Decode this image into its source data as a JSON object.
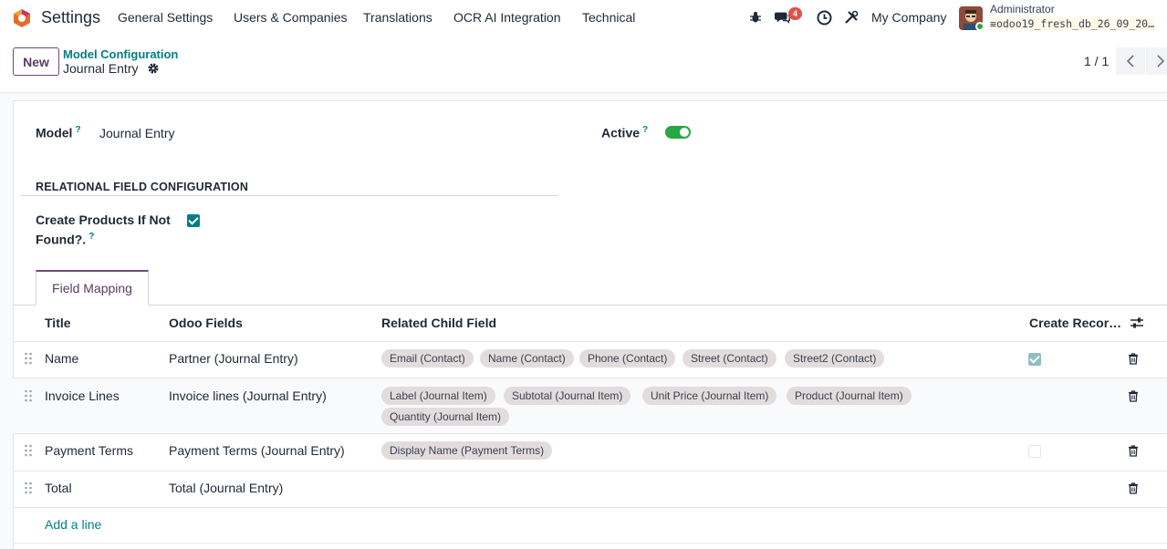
{
  "navbar": {
    "app_name": "Settings",
    "menu": [
      "General Settings",
      "Users & Companies",
      "Translations",
      "OCR AI Integration",
      "Technical"
    ],
    "message_badge": "4",
    "company": "My Company",
    "user": "Administrator",
    "database": "odoo19_fresh_db_26_09_20…"
  },
  "control": {
    "new_label": "New",
    "breadcrumb_parent": "Model Configuration",
    "breadcrumb_current": "Journal Entry",
    "pager": "1 / 1"
  },
  "form": {
    "model_label": "Model",
    "model_value": "Journal Entry",
    "active_label": "Active",
    "active": true,
    "section_title": "RELATIONAL FIELD CONFIGURATION",
    "create_products_label_1": "Create Products If Not",
    "create_products_label_2": "Found?.",
    "create_products": true,
    "help_mark": "?"
  },
  "tabs": [
    {
      "label": "Field Mapping",
      "active": true
    }
  ],
  "table": {
    "headers": [
      "Title",
      "Odoo Fields",
      "Related Child Field",
      "Create Recor…"
    ],
    "rows": [
      {
        "title": "Name",
        "field": "Partner (Journal Entry)",
        "tags": [
          "Email (Contact)",
          "Name (Contact)",
          "Phone (Contact)",
          "Street (Contact)",
          "Street2 (Contact)"
        ],
        "create": "checked"
      },
      {
        "title": "Invoice Lines",
        "field": "Invoice lines (Journal Entry)",
        "tags": [
          "Label (Journal Item)",
          "Subtotal (Journal Item)",
          "Unit Price (Journal Item)",
          "Product (Journal Item)",
          "Quantity (Journal Item)"
        ],
        "create": "none"
      },
      {
        "title": "Payment Terms",
        "field": "Payment Terms (Journal Entry)",
        "tags": [
          "Display Name (Payment Terms)"
        ],
        "create": "unchecked"
      },
      {
        "title": "Total",
        "field": "Total (Journal Entry)",
        "tags": [],
        "create": "none"
      }
    ],
    "add_line": "Add a line"
  },
  "colors": {
    "brand": "#71497a",
    "accent": "#017e84",
    "success": "#28a745",
    "badge": "#e1524a"
  },
  "icons": [
    "odoo-logo-icon",
    "bug-icon",
    "chat-icon",
    "clock-icon",
    "tools-icon",
    "gear-icon",
    "chevron-left-icon",
    "chevron-right-icon",
    "drag-handle-icon",
    "trash-icon",
    "optional-columns-icon",
    "database-icon"
  ]
}
